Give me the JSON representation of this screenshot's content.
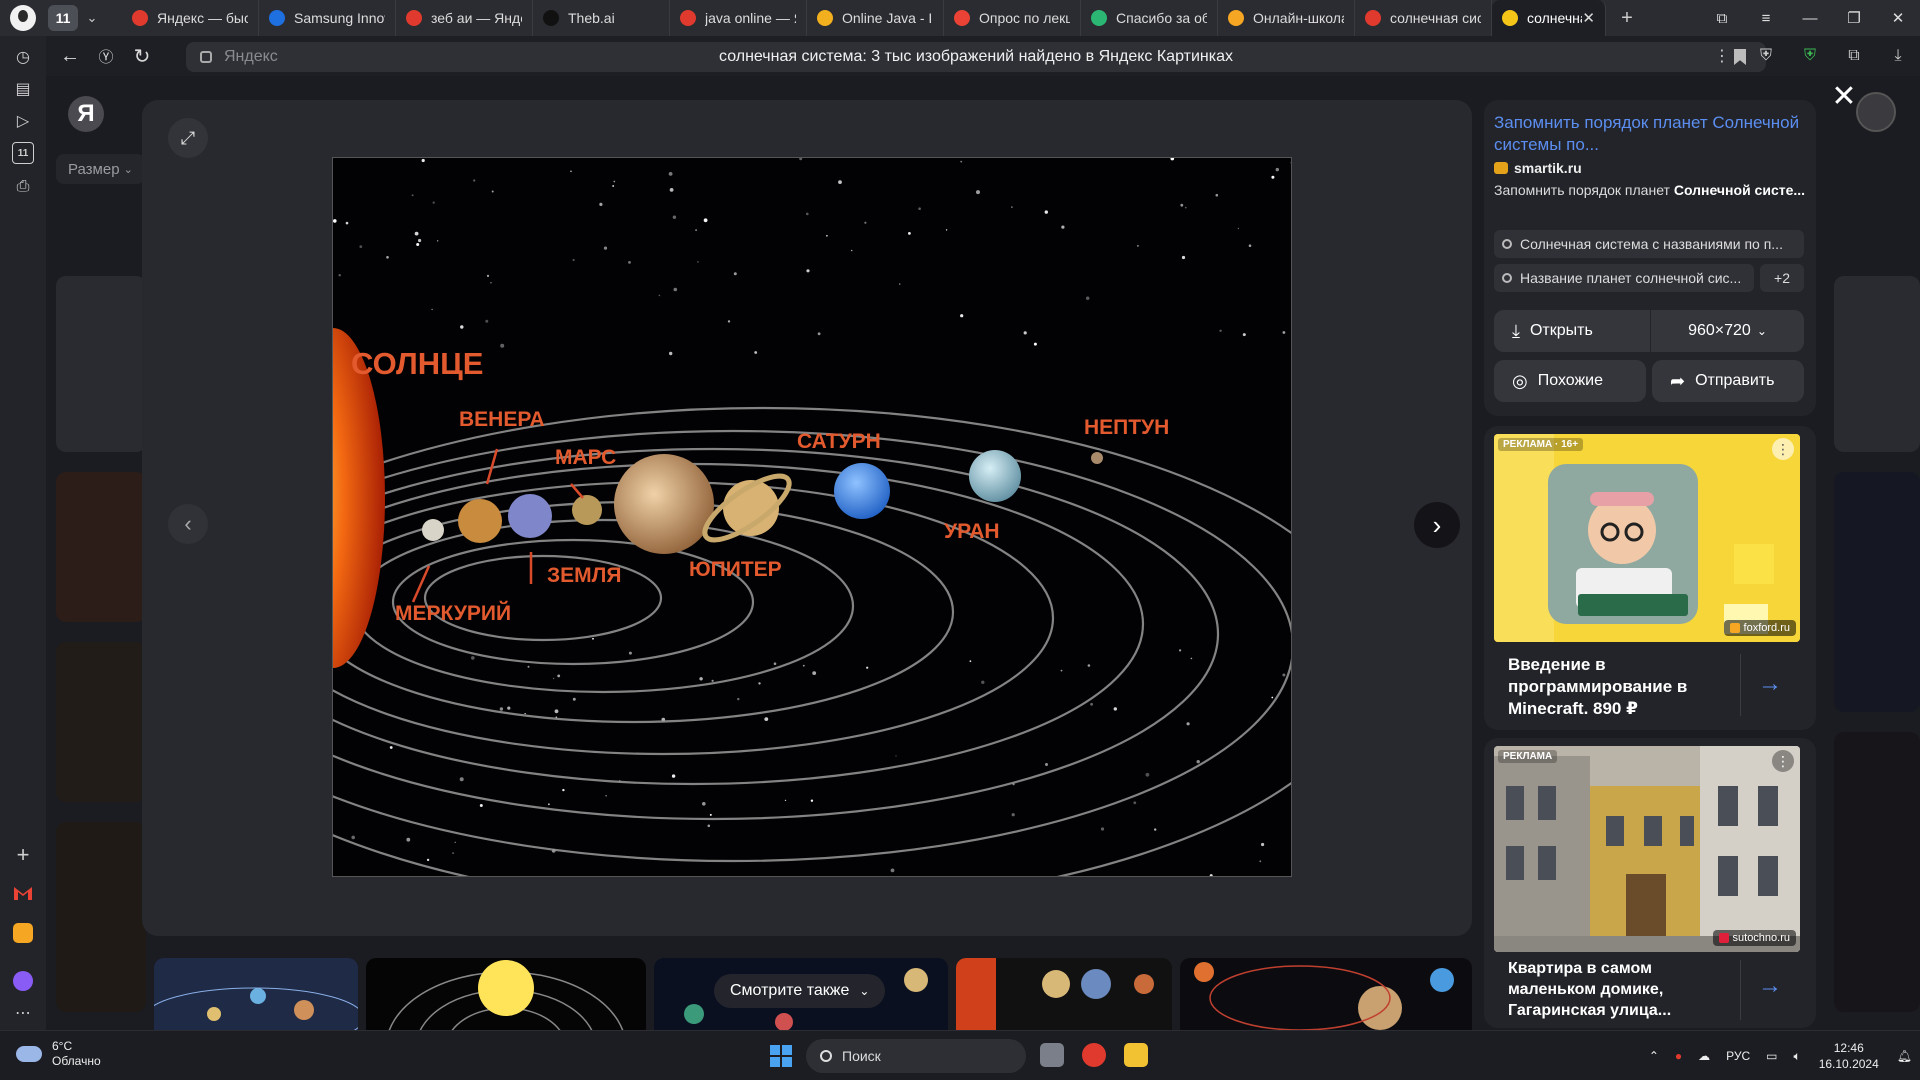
{
  "browser": {
    "tab_count": "11",
    "tabs": [
      {
        "label": "Яндекс — быст",
        "icon": "yandex-icon",
        "color": "#e03a2e"
      },
      {
        "label": "Samsung Innov",
        "icon": "samsung-icon",
        "color": "#1e6fe0"
      },
      {
        "label": "зеб аи — Янде",
        "icon": "yandex-icon",
        "color": "#e03a2e"
      },
      {
        "label": "Theb.ai",
        "icon": "thebai-icon",
        "color": "#111111"
      },
      {
        "label": "java online — Я",
        "icon": "yandex-icon",
        "color": "#e03a2e"
      },
      {
        "label": "Online Java - ID",
        "icon": "onlinegdb-icon",
        "color": "#f2b01e"
      },
      {
        "label": "Опрос по лекц",
        "icon": "gmail-icon",
        "color": "#ea4335"
      },
      {
        "label": "Спасибо за об",
        "icon": "shield-check-icon",
        "color": "#2bb673"
      },
      {
        "label": "Онлайн-школа",
        "icon": "foxford-icon",
        "color": "#f5a623"
      },
      {
        "label": "солнечная сис",
        "icon": "yandex-icon",
        "color": "#e03a2e"
      },
      {
        "label": "солнечная с",
        "icon": "yandex-images-icon",
        "color": "#f5c518",
        "active": true
      }
    ],
    "address": {
      "domain": "Яндекс",
      "page_title": "солнечная система: 3 тыс изображений найдено в Яндекс Картинках"
    }
  },
  "page": {
    "logo": "Я",
    "size_filter": "Размер"
  },
  "viewer": {
    "image_labels": {
      "sun": "СОЛНЦЕ",
      "mercury": "МЕРКУРИЙ",
      "venus": "ВЕНЕРА",
      "earth": "ЗЕМЛЯ",
      "mars": "МАРС",
      "jupiter": "ЮПИТЕР",
      "saturn": "САТУРН",
      "uranus": "УРАН",
      "neptune": "НЕПТУН"
    }
  },
  "info": {
    "title": "Запомнить порядок планет Солнечной системы по...",
    "site": "smartik.ru",
    "description_plain": "Запомнить порядок планет ",
    "description_bold": "Солнечной систе...",
    "related_queries": [
      "Солнечная система с названиями по п...",
      "Название планет солнечной сис..."
    ],
    "more_queries": "+2",
    "open_label": "Открыть",
    "resolution": "960×720",
    "similar_label": "Похожие",
    "share_label": "Отправить"
  },
  "ads": [
    {
      "tag": "РЕКЛАМА · 16+",
      "source": "foxford.ru",
      "text": "Введение в программирование в Minecraft. 890 ₽"
    },
    {
      "tag": "РЕКЛАМА",
      "source": "sutochno.ru",
      "text": "Квартира в самом маленьком домике, Гагаринская улица..."
    }
  ],
  "see_also": "Смотрите также",
  "taskbar": {
    "temperature": "6°C",
    "condition": "Облачно",
    "search_label": "Поиск",
    "language": "РУС",
    "time": "12:46",
    "date": "16.10.2024"
  }
}
